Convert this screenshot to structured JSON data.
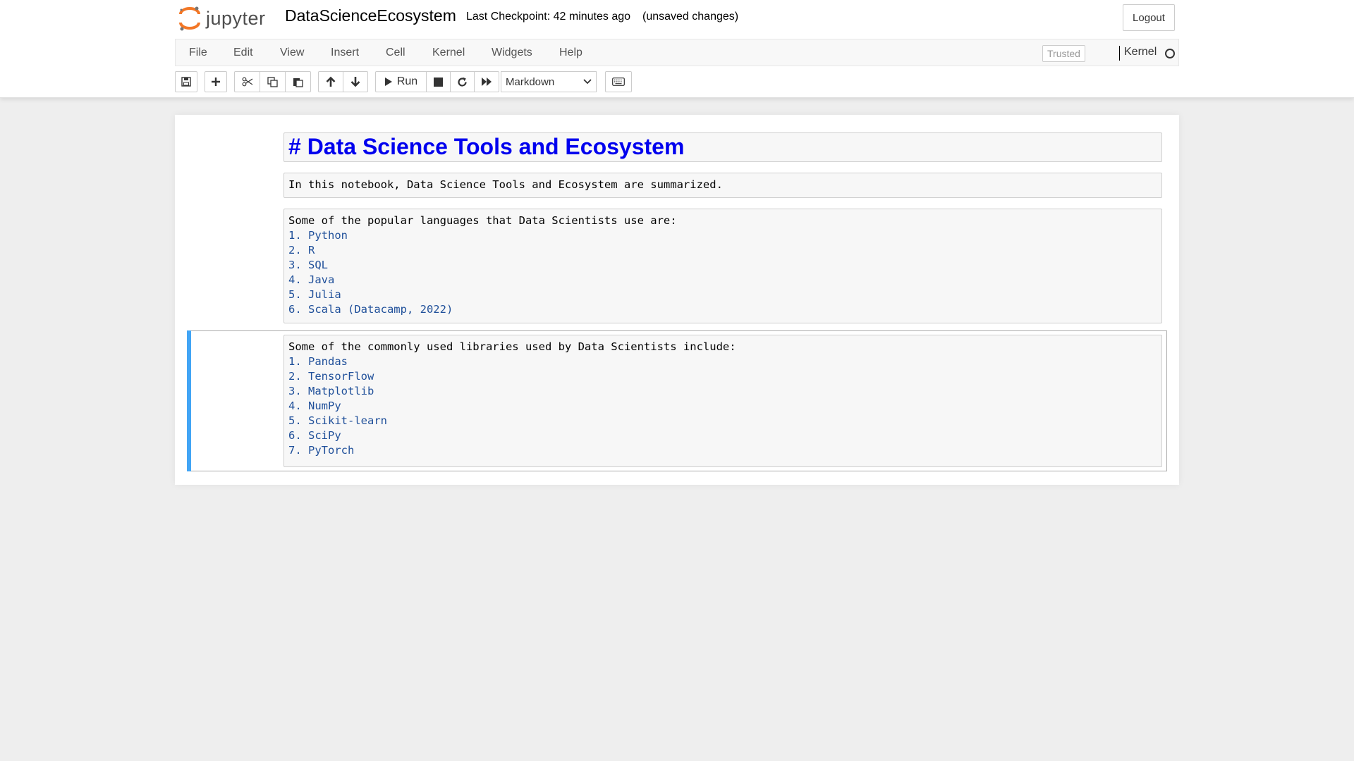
{
  "header": {
    "logo_text": "jupyter",
    "notebook_name": "DataScienceEcosystem",
    "checkpoint": "Last Checkpoint: 42 minutes ago",
    "autosave": "(unsaved changes)",
    "logout_label": "Logout"
  },
  "menu": {
    "items": [
      "File",
      "Edit",
      "View",
      "Insert",
      "Cell",
      "Kernel",
      "Widgets",
      "Help"
    ],
    "trusted_label": "Trusted",
    "kernel_label": "Kernel"
  },
  "toolbar": {
    "run_label": "Run",
    "cell_type": "Markdown"
  },
  "cells": {
    "c1": {
      "text": "# Data Science Tools and Ecosystem"
    },
    "c2": {
      "text": "In this notebook, Data Science Tools and Ecosystem are summarized."
    },
    "c3": {
      "intro": "Some of the popular languages that Data Scientists use are:",
      "items": [
        "1. Python",
        "2. R",
        "3. SQL",
        "4. Java",
        "5. Julia",
        "6. Scala (Datacamp, 2022)"
      ]
    },
    "c4": {
      "intro": "Some of the commonly used libraries used by Data Scientists include:",
      "items": [
        "1. Pandas",
        "2. TensorFlow",
        "3. Matplotlib",
        "4. NumPy",
        "5. Scikit-learn",
        "6. SciPy",
        "7. PyTorch"
      ]
    },
    "selected_accent": "#42a5f5"
  }
}
